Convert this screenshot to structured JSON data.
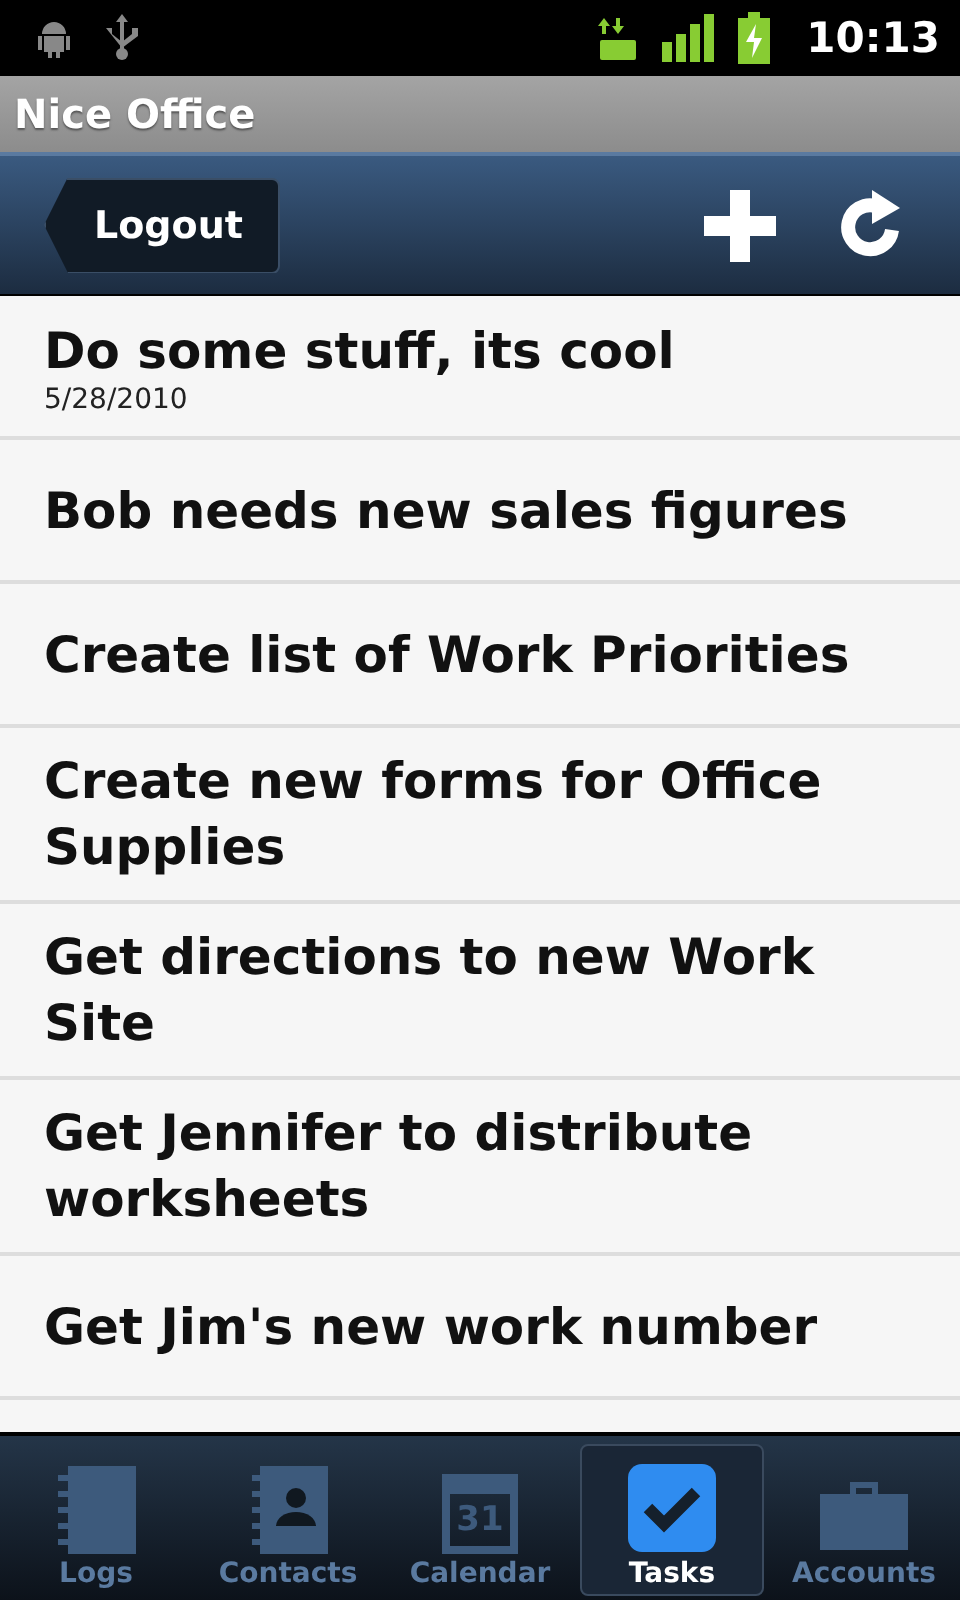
{
  "status_bar": {
    "time": "10:13"
  },
  "window": {
    "title": "Nice Office"
  },
  "toolbar": {
    "back_label": "Logout"
  },
  "tasks": [
    {
      "title": "Do some stuff, its cool",
      "date": "5/28/2010"
    },
    {
      "title": "Bob needs new sales figures"
    },
    {
      "title": "Create list of Work Priorities"
    },
    {
      "title": "Create new forms for Office Supplies"
    },
    {
      "title": "Get directions to new Work Site"
    },
    {
      "title": "Get Jennifer to distribute worksheets"
    },
    {
      "title": "Get Jim's new work number"
    }
  ],
  "tabs": [
    {
      "label": "Logs",
      "kind": "logs",
      "selected": false
    },
    {
      "label": "Contacts",
      "kind": "contacts",
      "selected": false
    },
    {
      "label": "Calendar",
      "kind": "calendar",
      "icon_text": "31",
      "selected": false
    },
    {
      "label": "Tasks",
      "kind": "tasks",
      "selected": true
    },
    {
      "label": "Accounts",
      "kind": "accounts",
      "selected": false
    }
  ]
}
